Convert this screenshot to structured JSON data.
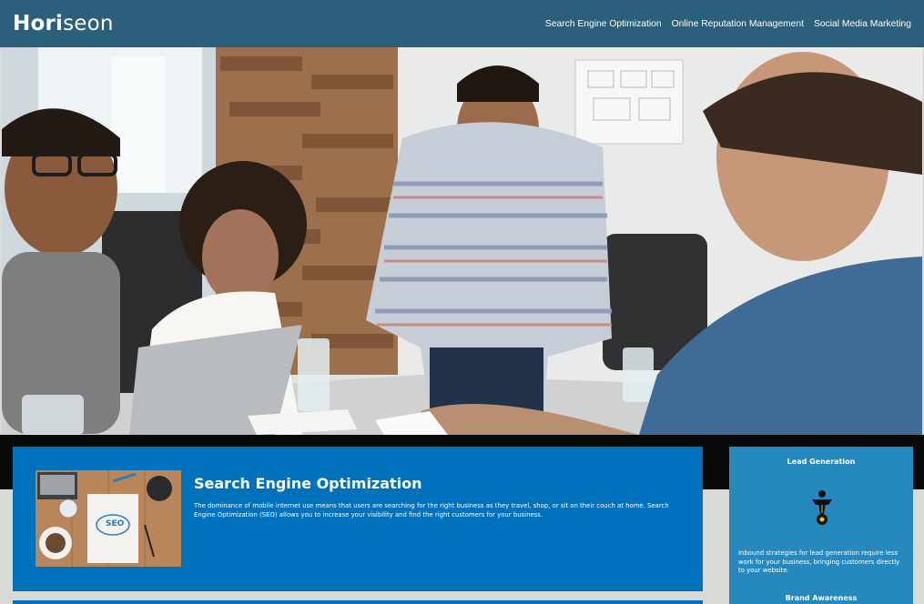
{
  "header": {
    "logo_primary": "Hori",
    "logo_secondary": "seon",
    "nav": [
      {
        "label": "Search Engine Optimization"
      },
      {
        "label": "Online Reputation Management"
      },
      {
        "label": "Social Media Marketing"
      }
    ]
  },
  "hero": {
    "image_description_icon": "team-meeting-photo"
  },
  "main": {
    "seo": {
      "title": "Search Engine Optimization",
      "text": "The dominance of mobile internet use means that users are searching for the right business as they travel, shop, or sit on their couch at home. Search Engine Optimization (SEO) allows you to increase your visibility and find the right customers for your business.",
      "image_label": "SEO"
    }
  },
  "sidebar": {
    "items": [
      {
        "title": "Lead Generation",
        "icon": "lead-generation-icon",
        "text": "Inbound strategies for lead generation require less work for your business, bringing customers directly to your website."
      },
      {
        "title": "Brand Awareness"
      }
    ]
  },
  "colors": {
    "header_bg": "#2a607c",
    "card_bg": "#0072bb",
    "sidebar_bg": "#2589bd",
    "band_bg": "#0a0a0a"
  }
}
